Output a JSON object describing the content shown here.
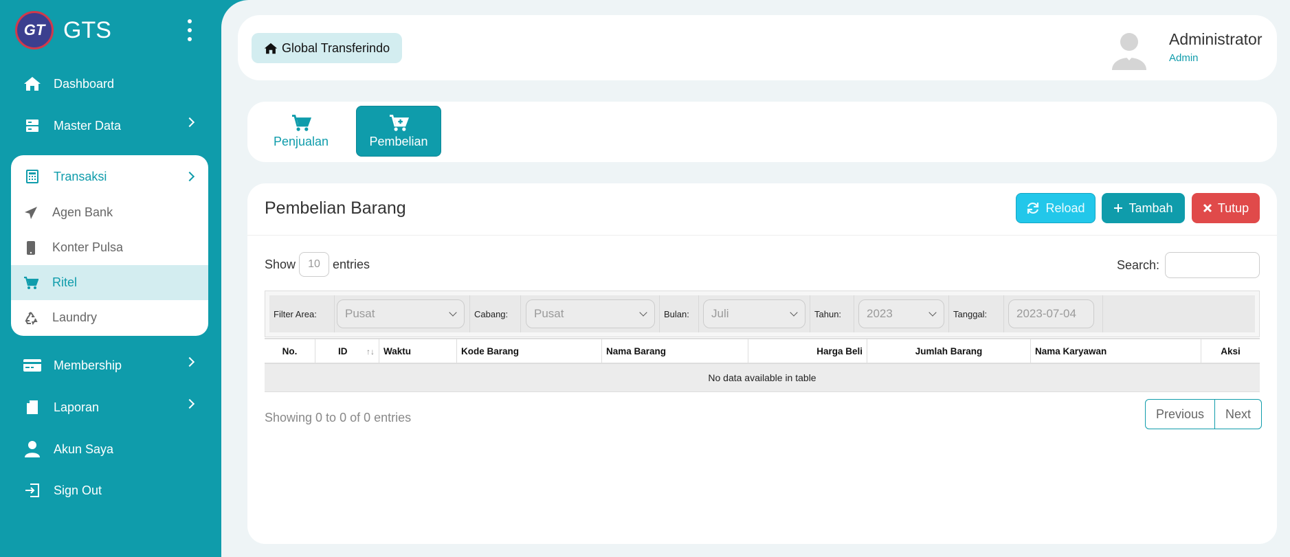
{
  "brand": {
    "logo_text": "GT",
    "name": "GTS"
  },
  "sidebar": {
    "items": [
      {
        "label": "Dashboard",
        "icon": "home-icon"
      },
      {
        "label": "Master Data",
        "icon": "server-icon"
      },
      {
        "label": "Membership",
        "icon": "credit-card-icon"
      },
      {
        "label": "Laporan",
        "icon": "book-icon"
      },
      {
        "label": "Akun Saya",
        "icon": "user-icon"
      },
      {
        "label": "Sign Out",
        "icon": "sign-out-icon"
      }
    ],
    "transaksi": {
      "label": "Transaksi",
      "icon": "calculator-icon",
      "children": [
        {
          "label": "Agen Bank",
          "icon": "paper-plane-icon"
        },
        {
          "label": "Konter Pulsa",
          "icon": "mobile-icon"
        },
        {
          "label": "Ritel",
          "icon": "cart-icon",
          "active": true
        },
        {
          "label": "Laundry",
          "icon": "recycle-icon"
        }
      ]
    }
  },
  "header": {
    "home_label": "Global Transferindo",
    "user_name": "Administrator",
    "user_role": "Admin"
  },
  "tabs": [
    {
      "label": "Penjualan",
      "icon": "cart-icon",
      "active": false
    },
    {
      "label": "Pembelian",
      "icon": "cart-plus-icon",
      "active": true
    }
  ],
  "card": {
    "title": "Pembelian Barang",
    "reload_label": "Reload",
    "tambah_label": "Tambah",
    "tutup_label": "Tutup"
  },
  "table_controls": {
    "show_label": "Show",
    "page_length": "10",
    "entries_label": "entries",
    "search_label": "Search:"
  },
  "filters": {
    "area_label": "Filter Area:",
    "area_value": "Pusat",
    "cabang_label": "Cabang:",
    "cabang_value": "Pusat",
    "bulan_label": "Bulan:",
    "bulan_value": "Juli",
    "tahun_label": "Tahun:",
    "tahun_value": "2023",
    "tanggal_label": "Tanggal:",
    "tanggal_value": "2023-07-04"
  },
  "table": {
    "columns": [
      "No.",
      "ID",
      "Waktu",
      "Kode Barang",
      "Nama Barang",
      "Harga Beli",
      "Jumlah Barang",
      "Nama Karyawan",
      "Aksi"
    ],
    "empty_message": "No data available in table"
  },
  "footer": {
    "info": "Showing 0 to 0 of 0 entries",
    "previous": "Previous",
    "next": "Next"
  },
  "colors": {
    "primary": "#0f9cab",
    "reload": "#22c7ea",
    "danger": "#e04a4a",
    "background": "#eef4f6"
  }
}
